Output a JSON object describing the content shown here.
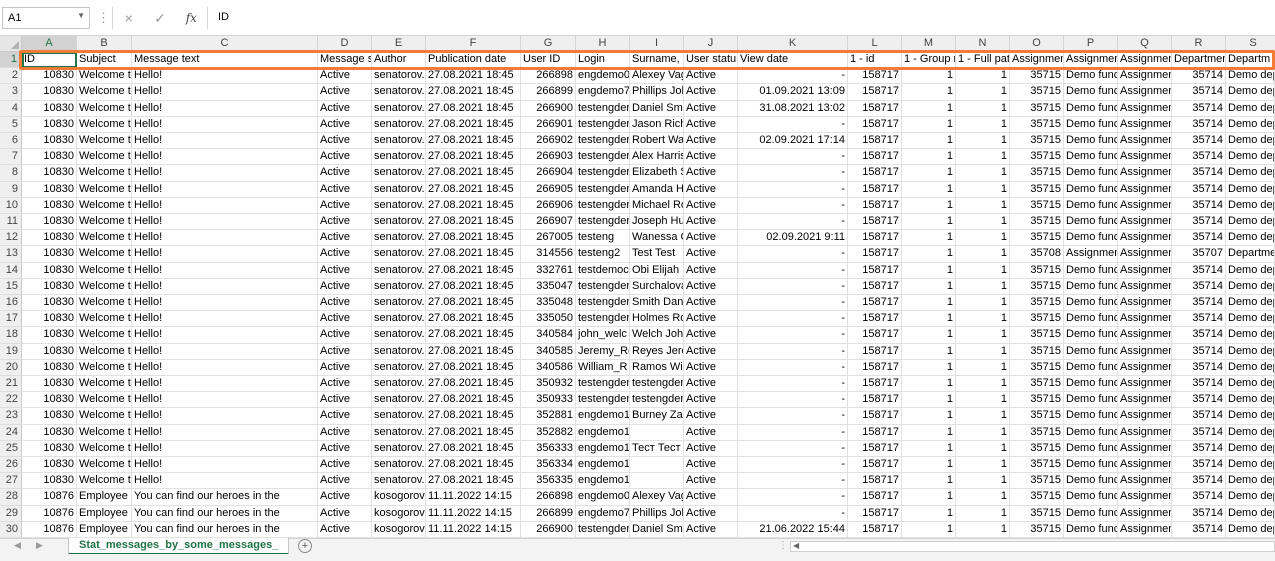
{
  "formula_bar": {
    "name_box": "A1",
    "content": "ID",
    "cancel_icon": "×",
    "enter_icon": "✓",
    "fx_label": "fx"
  },
  "columns": [
    "A",
    "B",
    "C",
    "D",
    "E",
    "F",
    "G",
    "H",
    "I",
    "J",
    "K",
    "L",
    "M",
    "N",
    "O",
    "P",
    "Q",
    "R",
    "S"
  ],
  "header_row": [
    "ID",
    "Subject",
    "Message text",
    "Message s",
    "Author",
    "Publication date",
    "User ID",
    "Login",
    "Surname, N",
    "User statu",
    "View date",
    "1 - id",
    "1 - Group r",
    "1 - Full pat",
    "Assignmen",
    "Assignmen",
    "Assignmen",
    "Departmen",
    "Departm"
  ],
  "rows": [
    [
      "10830",
      "Welcome t",
      "Hello!",
      "Active",
      "senatorov.",
      "27.08.2021 18:45",
      "266898",
      "engdemo0",
      "Alexey Vag",
      "Active",
      "-",
      "158717",
      "1",
      "1",
      "35715",
      "Demo func",
      "Assignmen",
      "35714",
      "Demo dep"
    ],
    [
      "10830",
      "Welcome t",
      "Hello!",
      "Active",
      "senatorov.",
      "27.08.2021 18:45",
      "266899",
      "engdemo7",
      "Phillips Joh",
      "Active",
      "01.09.2021 13:09",
      "158717",
      "1",
      "1",
      "35715",
      "Demo func",
      "Assignmen",
      "35714",
      "Demo dep"
    ],
    [
      "10830",
      "Welcome t",
      "Hello!",
      "Active",
      "senatorov.",
      "27.08.2021 18:45",
      "266900",
      "testengder",
      "Daniel Smi",
      "Active",
      "31.08.2021 13:02",
      "158717",
      "1",
      "1",
      "35715",
      "Demo func",
      "Assignmen",
      "35714",
      "Demo dep"
    ],
    [
      "10830",
      "Welcome t",
      "Hello!",
      "Active",
      "senatorov.",
      "27.08.2021 18:45",
      "266901",
      "testengder",
      "Jason Rich",
      "Active",
      "-",
      "158717",
      "1",
      "1",
      "35715",
      "Demo func",
      "Assignmen",
      "35714",
      "Demo dep"
    ],
    [
      "10830",
      "Welcome t",
      "Hello!",
      "Active",
      "senatorov.",
      "27.08.2021 18:45",
      "266902",
      "testengder",
      "Robert Wa",
      "Active",
      "02.09.2021 17:14",
      "158717",
      "1",
      "1",
      "35715",
      "Demo func",
      "Assignmen",
      "35714",
      "Demo dep"
    ],
    [
      "10830",
      "Welcome t",
      "Hello!",
      "Active",
      "senatorov.",
      "27.08.2021 18:45",
      "266903",
      "testengder",
      "Alex Harris",
      "Active",
      "-",
      "158717",
      "1",
      "1",
      "35715",
      "Demo func",
      "Assignmen",
      "35714",
      "Demo dep"
    ],
    [
      "10830",
      "Welcome t",
      "Hello!",
      "Active",
      "senatorov.",
      "27.08.2021 18:45",
      "266904",
      "testengder",
      "Elizabeth S",
      "Active",
      "-",
      "158717",
      "1",
      "1",
      "35715",
      "Demo func",
      "Assignmen",
      "35714",
      "Demo dep"
    ],
    [
      "10830",
      "Welcome t",
      "Hello!",
      "Active",
      "senatorov.",
      "27.08.2021 18:45",
      "266905",
      "testengder",
      "Amanda H",
      "Active",
      "-",
      "158717",
      "1",
      "1",
      "35715",
      "Demo func",
      "Assignmen",
      "35714",
      "Demo dep"
    ],
    [
      "10830",
      "Welcome t",
      "Hello!",
      "Active",
      "senatorov.",
      "27.08.2021 18:45",
      "266906",
      "testengder",
      "Michael Ro",
      "Active",
      "-",
      "158717",
      "1",
      "1",
      "35715",
      "Demo func",
      "Assignmen",
      "35714",
      "Demo dep"
    ],
    [
      "10830",
      "Welcome t",
      "Hello!",
      "Active",
      "senatorov.",
      "27.08.2021 18:45",
      "266907",
      "testengder",
      "Joseph Hu",
      "Active",
      "-",
      "158717",
      "1",
      "1",
      "35715",
      "Demo func",
      "Assignmen",
      "35714",
      "Demo dep"
    ],
    [
      "10830",
      "Welcome t",
      "Hello!",
      "Active",
      "senatorov.",
      "27.08.2021 18:45",
      "267005",
      "testeng",
      "Wanessa C",
      "Active",
      "02.09.2021 9:11",
      "158717",
      "1",
      "1",
      "35715",
      "Demo func",
      "Assignmen",
      "35714",
      "Demo dep"
    ],
    [
      "10830",
      "Welcome t",
      "Hello!",
      "Active",
      "senatorov.",
      "27.08.2021 18:45",
      "314556",
      "testeng2",
      "Test Test",
      "Active",
      "-",
      "158717",
      "1",
      "1",
      "35708",
      "Assignmen",
      "Assignmen",
      "35707",
      "Departme"
    ],
    [
      "10830",
      "Welcome t",
      "Hello!",
      "Active",
      "senatorov.",
      "27.08.2021 18:45",
      "332761",
      "testdemoc",
      "Obi Elijah",
      "Active",
      "-",
      "158717",
      "1",
      "1",
      "35715",
      "Demo func",
      "Assignmen",
      "35714",
      "Demo dep"
    ],
    [
      "10830",
      "Welcome t",
      "Hello!",
      "Active",
      "senatorov.",
      "27.08.2021 18:45",
      "335047",
      "testengder",
      "Surchalova",
      "Active",
      "-",
      "158717",
      "1",
      "1",
      "35715",
      "Demo func",
      "Assignmen",
      "35714",
      "Demo dep"
    ],
    [
      "10830",
      "Welcome t",
      "Hello!",
      "Active",
      "senatorov.",
      "27.08.2021 18:45",
      "335048",
      "testengder",
      "Smith Dani",
      "Active",
      "-",
      "158717",
      "1",
      "1",
      "35715",
      "Demo func",
      "Assignmen",
      "35714",
      "Demo dep"
    ],
    [
      "10830",
      "Welcome t",
      "Hello!",
      "Active",
      "senatorov.",
      "27.08.2021 18:45",
      "335050",
      "testengder",
      "Holmes Ro",
      "Active",
      "-",
      "158717",
      "1",
      "1",
      "35715",
      "Demo func",
      "Assignmen",
      "35714",
      "Demo dep"
    ],
    [
      "10830",
      "Welcome t",
      "Hello!",
      "Active",
      "senatorov.",
      "27.08.2021 18:45",
      "340584",
      "john_welc",
      "Welch Joh",
      "Active",
      "-",
      "158717",
      "1",
      "1",
      "35715",
      "Demo func",
      "Assignmen",
      "35714",
      "Demo dep"
    ],
    [
      "10830",
      "Welcome t",
      "Hello!",
      "Active",
      "senatorov.",
      "27.08.2021 18:45",
      "340585",
      "Jeremy_Re",
      "Reyes Jere",
      "Active",
      "-",
      "158717",
      "1",
      "1",
      "35715",
      "Demo func",
      "Assignmen",
      "35714",
      "Demo dep"
    ],
    [
      "10830",
      "Welcome t",
      "Hello!",
      "Active",
      "senatorov.",
      "27.08.2021 18:45",
      "340586",
      "William_R",
      "Ramos Wil",
      "Active",
      "-",
      "158717",
      "1",
      "1",
      "35715",
      "Demo func",
      "Assignmen",
      "35714",
      "Demo dep"
    ],
    [
      "10830",
      "Welcome t",
      "Hello!",
      "Active",
      "senatorov.",
      "27.08.2021 18:45",
      "350932",
      "testengder",
      "testengder",
      "Active",
      "-",
      "158717",
      "1",
      "1",
      "35715",
      "Demo func",
      "Assignmen",
      "35714",
      "Demo dep"
    ],
    [
      "10830",
      "Welcome t",
      "Hello!",
      "Active",
      "senatorov.",
      "27.08.2021 18:45",
      "350933",
      "testengder",
      "testengder",
      "Active",
      "-",
      "158717",
      "1",
      "1",
      "35715",
      "Demo func",
      "Assignmen",
      "35714",
      "Demo dep"
    ],
    [
      "10830",
      "Welcome t",
      "Hello!",
      "Active",
      "senatorov.",
      "27.08.2021 18:45",
      "352881",
      "engdemo1",
      "Burney Zai",
      "Active",
      "-",
      "158717",
      "1",
      "1",
      "35715",
      "Demo func",
      "Assignmen",
      "35714",
      "Demo dep"
    ],
    [
      "10830",
      "Welcome t",
      "Hello!",
      "Active",
      "senatorov.",
      "27.08.2021 18:45",
      "352882",
      "engdemo13",
      "",
      "Active",
      "-",
      "158717",
      "1",
      "1",
      "35715",
      "Demo func",
      "Assignmen",
      "35714",
      "Demo dep"
    ],
    [
      "10830",
      "Welcome t",
      "Hello!",
      "Active",
      "senatorov.",
      "27.08.2021 18:45",
      "356333",
      "engdemo1",
      "Тест Тест",
      "Active",
      "-",
      "158717",
      "1",
      "1",
      "35715",
      "Demo func",
      "Assignmen",
      "35714",
      "Demo dep"
    ],
    [
      "10830",
      "Welcome t",
      "Hello!",
      "Active",
      "senatorov.",
      "27.08.2021 18:45",
      "356334",
      "engdemo15",
      "",
      "Active",
      "-",
      "158717",
      "1",
      "1",
      "35715",
      "Demo func",
      "Assignmen",
      "35714",
      "Demo dep"
    ],
    [
      "10830",
      "Welcome t",
      "Hello!",
      "Active",
      "senatorov.",
      "27.08.2021 18:45",
      "356335",
      "engdemo16",
      "",
      "Active",
      "-",
      "158717",
      "1",
      "1",
      "35715",
      "Demo func",
      "Assignmen",
      "35714",
      "Demo dep"
    ],
    [
      "10876",
      "Employee",
      "You can find our heroes in the",
      "Active",
      "kosogorov",
      "11.11.2022 14:15",
      "266898",
      "engdemo0",
      "Alexey Vag",
      "Active",
      "-",
      "158717",
      "1",
      "1",
      "35715",
      "Demo func",
      "Assignmen",
      "35714",
      "Demo dep"
    ],
    [
      "10876",
      "Employee",
      "You can find our heroes in the",
      "Active",
      "kosogorov",
      "11.11.2022 14:15",
      "266899",
      "engdemo7",
      "Phillips Joh",
      "Active",
      "-",
      "158717",
      "1",
      "1",
      "35715",
      "Demo func",
      "Assignmen",
      "35714",
      "Demo dep"
    ],
    [
      "10876",
      "Employee",
      "You can find our heroes in the",
      "Active",
      "kosogorov",
      "11.11.2022 14:15",
      "266900",
      "testengder",
      "Daniel Smi",
      "Active",
      "21.06.2022 15:44",
      "158717",
      "1",
      "1",
      "35715",
      "Demo func",
      "Assignmen",
      "35714",
      "Demo dep"
    ]
  ],
  "sheet_tab": "Stat_messages_by_some_messages_",
  "add_sheet_icon": "+"
}
